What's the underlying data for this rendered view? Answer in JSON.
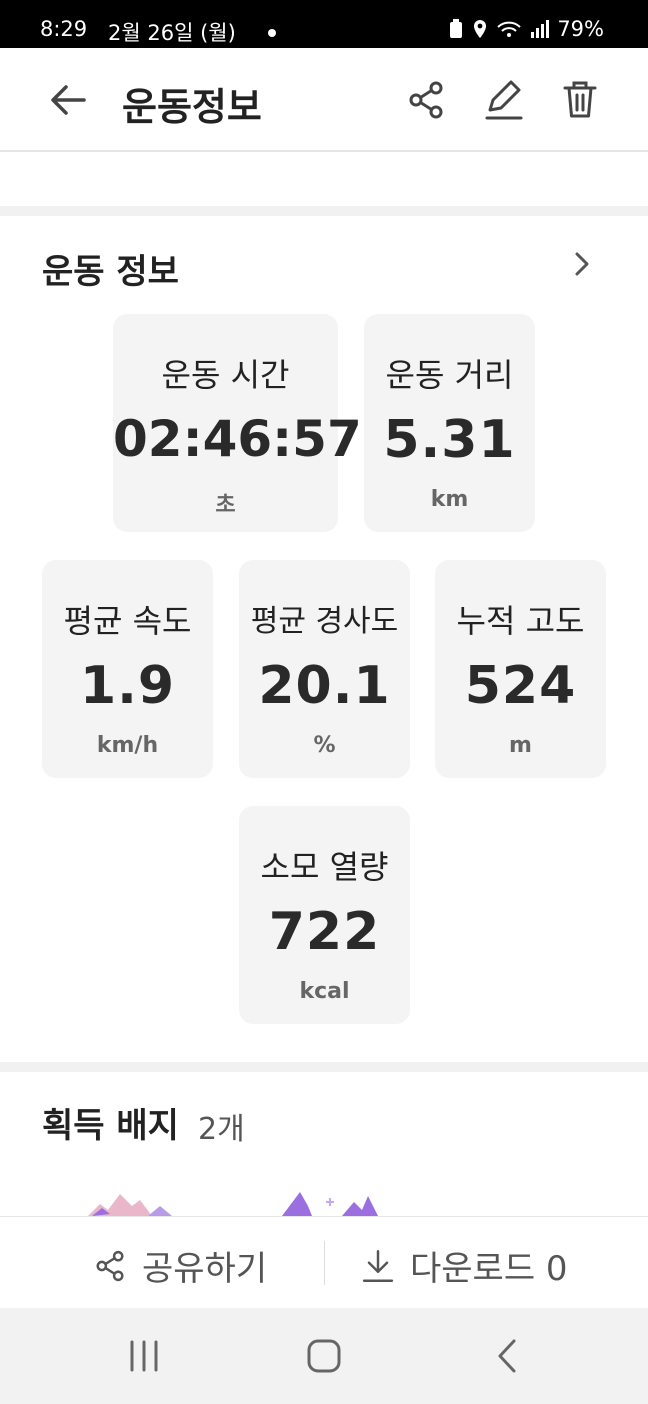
{
  "status_bar": {
    "time": "8:29",
    "date": "2월 26일 (월)",
    "battery": "79%"
  },
  "app_bar": {
    "title": "운동정보",
    "icons": [
      "back-arrow-icon",
      "share-icon",
      "edit-pencil-icon",
      "trash-icon"
    ]
  },
  "workout": {
    "section_title": "운동 정보",
    "stats": {
      "time": {
        "label": "운동 시간",
        "value": "02:46:57",
        "unit": "초"
      },
      "distance": {
        "label": "운동 거리",
        "value": "5.31",
        "unit": "km"
      },
      "avg_speed": {
        "label": "평균 속도",
        "value": "1.9",
        "unit": "km/h"
      },
      "avg_slope": {
        "label": "평균 경사도",
        "value": "20.1",
        "unit": "%"
      },
      "elevation": {
        "label": "누적 고도",
        "value": "524",
        "unit": "m"
      },
      "calories": {
        "label": "소모 열량",
        "value": "722",
        "unit": "kcal"
      }
    }
  },
  "badges": {
    "title": "획득 배지",
    "count": "2개"
  },
  "actions": {
    "share_label": "공유하기",
    "download_label": "다운로드 0"
  },
  "colors": {
    "card_bg": "#f4f4f4",
    "band_bg": "#f1f1f1",
    "badge_purple": "#9b6fe0",
    "badge_pink": "#f2a0b8"
  }
}
